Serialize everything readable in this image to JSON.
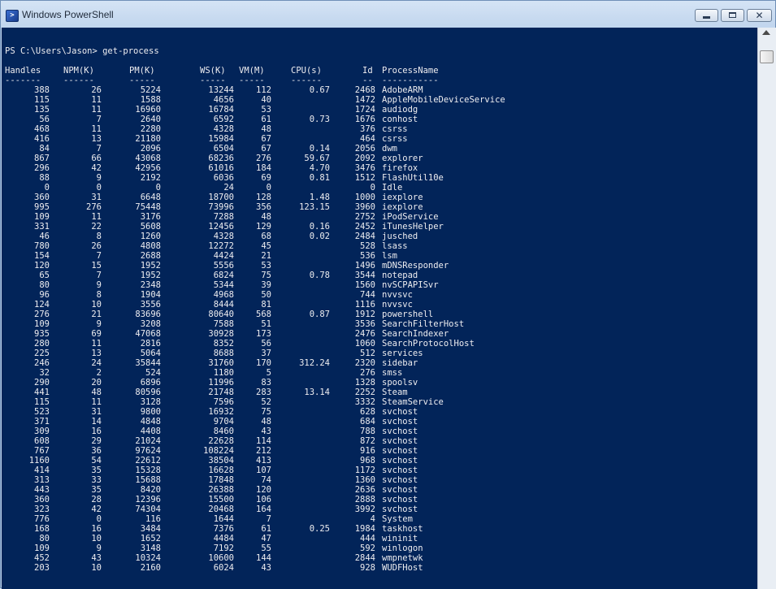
{
  "window": {
    "title": "Windows PowerShell",
    "icon": "powershell-icon"
  },
  "console": {
    "prompt": "PS C:\\Users\\Jason> get-process",
    "headers": [
      "Handles",
      "NPM(K)",
      "PM(K)",
      "WS(K)",
      "VM(M)",
      "CPU(s)",
      "Id",
      "ProcessName"
    ],
    "dashes": [
      "-------",
      "------",
      "-----",
      "-----",
      "-----",
      "------",
      "--",
      "-----------"
    ],
    "rows": [
      [
        "388",
        "26",
        "5224",
        "13244",
        "112",
        "0.67",
        "2468",
        "AdobeARM"
      ],
      [
        "115",
        "11",
        "1588",
        "4656",
        "40",
        "",
        "1472",
        "AppleMobileDeviceService"
      ],
      [
        "135",
        "11",
        "16960",
        "16784",
        "53",
        "",
        "1724",
        "audiodg"
      ],
      [
        "56",
        "7",
        "2640",
        "6592",
        "61",
        "0.73",
        "1676",
        "conhost"
      ],
      [
        "468",
        "11",
        "2280",
        "4328",
        "48",
        "",
        "376",
        "csrss"
      ],
      [
        "416",
        "13",
        "21180",
        "15984",
        "67",
        "",
        "464",
        "csrss"
      ],
      [
        "84",
        "7",
        "2096",
        "6504",
        "67",
        "0.14",
        "2056",
        "dwm"
      ],
      [
        "867",
        "66",
        "43068",
        "68236",
        "276",
        "59.67",
        "2092",
        "explorer"
      ],
      [
        "296",
        "42",
        "42956",
        "61016",
        "184",
        "4.70",
        "3476",
        "firefox"
      ],
      [
        "88",
        "9",
        "2192",
        "6036",
        "69",
        "0.81",
        "1512",
        "FlashUtil10e"
      ],
      [
        "0",
        "0",
        "0",
        "24",
        "0",
        "",
        "0",
        "Idle"
      ],
      [
        "360",
        "31",
        "6648",
        "18700",
        "128",
        "1.48",
        "1000",
        "iexplore"
      ],
      [
        "995",
        "276",
        "75448",
        "73996",
        "356",
        "123.15",
        "3960",
        "iexplore"
      ],
      [
        "109",
        "11",
        "3176",
        "7288",
        "48",
        "",
        "2752",
        "iPodService"
      ],
      [
        "331",
        "22",
        "5608",
        "12456",
        "129",
        "0.16",
        "2452",
        "iTunesHelper"
      ],
      [
        "46",
        "8",
        "1260",
        "4328",
        "68",
        "0.02",
        "2484",
        "jusched"
      ],
      [
        "780",
        "26",
        "4808",
        "12272",
        "45",
        "",
        "528",
        "lsass"
      ],
      [
        "154",
        "7",
        "2688",
        "4424",
        "21",
        "",
        "536",
        "lsm"
      ],
      [
        "120",
        "15",
        "1952",
        "5556",
        "53",
        "",
        "1496",
        "mDNSResponder"
      ],
      [
        "65",
        "7",
        "1952",
        "6824",
        "75",
        "0.78",
        "3544",
        "notepad"
      ],
      [
        "80",
        "9",
        "2348",
        "5344",
        "39",
        "",
        "1560",
        "nvSCPAPISvr"
      ],
      [
        "96",
        "8",
        "1904",
        "4968",
        "50",
        "",
        "744",
        "nvvsvc"
      ],
      [
        "124",
        "10",
        "3556",
        "8444",
        "81",
        "",
        "1116",
        "nvvsvc"
      ],
      [
        "276",
        "21",
        "83696",
        "80640",
        "568",
        "0.87",
        "1912",
        "powershell"
      ],
      [
        "109",
        "9",
        "3208",
        "7588",
        "51",
        "",
        "3536",
        "SearchFilterHost"
      ],
      [
        "935",
        "69",
        "47068",
        "30928",
        "173",
        "",
        "2476",
        "SearchIndexer"
      ],
      [
        "280",
        "11",
        "2816",
        "8352",
        "56",
        "",
        "1060",
        "SearchProtocolHost"
      ],
      [
        "225",
        "13",
        "5064",
        "8688",
        "37",
        "",
        "512",
        "services"
      ],
      [
        "246",
        "24",
        "35844",
        "31760",
        "170",
        "312.24",
        "2320",
        "sidebar"
      ],
      [
        "32",
        "2",
        "524",
        "1180",
        "5",
        "",
        "276",
        "smss"
      ],
      [
        "290",
        "20",
        "6896",
        "11996",
        "83",
        "",
        "1328",
        "spoolsv"
      ],
      [
        "441",
        "48",
        "80596",
        "21748",
        "283",
        "13.14",
        "2252",
        "Steam"
      ],
      [
        "115",
        "11",
        "3128",
        "7596",
        "52",
        "",
        "3332",
        "SteamService"
      ],
      [
        "523",
        "31",
        "9800",
        "16932",
        "75",
        "",
        "628",
        "svchost"
      ],
      [
        "371",
        "14",
        "4848",
        "9704",
        "48",
        "",
        "684",
        "svchost"
      ],
      [
        "309",
        "16",
        "4408",
        "8460",
        "43",
        "",
        "788",
        "svchost"
      ],
      [
        "608",
        "29",
        "21024",
        "22628",
        "114",
        "",
        "872",
        "svchost"
      ],
      [
        "767",
        "36",
        "97624",
        "108224",
        "212",
        "",
        "916",
        "svchost"
      ],
      [
        "1160",
        "54",
        "22612",
        "38504",
        "413",
        "",
        "968",
        "svchost"
      ],
      [
        "414",
        "35",
        "15328",
        "16628",
        "107",
        "",
        "1172",
        "svchost"
      ],
      [
        "313",
        "33",
        "15688",
        "17848",
        "74",
        "",
        "1360",
        "svchost"
      ],
      [
        "443",
        "35",
        "8420",
        "26388",
        "120",
        "",
        "2636",
        "svchost"
      ],
      [
        "360",
        "28",
        "12396",
        "15500",
        "106",
        "",
        "2888",
        "svchost"
      ],
      [
        "323",
        "42",
        "74304",
        "20468",
        "164",
        "",
        "3992",
        "svchost"
      ],
      [
        "776",
        "0",
        "116",
        "1644",
        "7",
        "",
        "4",
        "System"
      ],
      [
        "168",
        "16",
        "3484",
        "7376",
        "61",
        "0.25",
        "1984",
        "taskhost"
      ],
      [
        "80",
        "10",
        "1652",
        "4484",
        "47",
        "",
        "444",
        "wininit"
      ],
      [
        "109",
        "9",
        "3148",
        "7192",
        "55",
        "",
        "592",
        "winlogon"
      ],
      [
        "452",
        "43",
        "10324",
        "10600",
        "144",
        "",
        "2844",
        "wmpnetwk"
      ],
      [
        "203",
        "10",
        "2160",
        "6024",
        "43",
        "",
        "928",
        "WUDFHost"
      ]
    ]
  }
}
